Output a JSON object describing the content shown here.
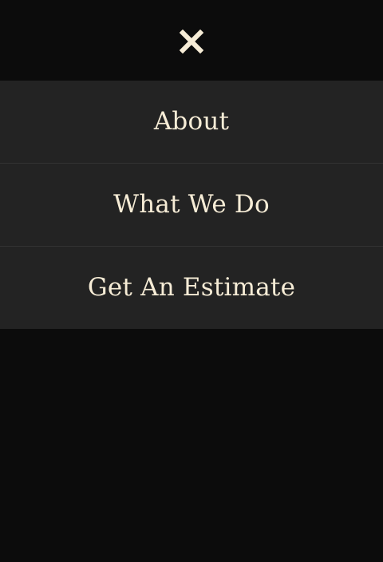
{
  "header": {
    "close_icon": "close-icon",
    "close_label": "Close menu"
  },
  "menu": {
    "items": [
      {
        "label": "About"
      },
      {
        "label": "What We Do"
      },
      {
        "label": "Get An Estimate"
      }
    ]
  },
  "colors": {
    "background": "#0c0c0c",
    "menu_background": "#232323",
    "divider": "#323232",
    "text": "#f6ecd6",
    "icon": "#f6ecd6"
  }
}
